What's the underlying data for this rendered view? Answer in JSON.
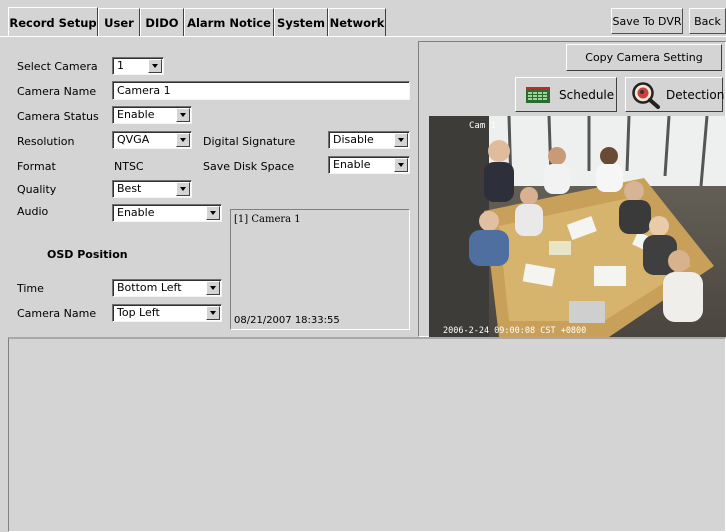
{
  "tabs": [
    {
      "label": "Record Setup",
      "active": true
    },
    {
      "label": "User"
    },
    {
      "label": "DIDO"
    },
    {
      "label": "Alarm Notice"
    },
    {
      "label": "System"
    },
    {
      "label": "Network"
    }
  ],
  "toolbar": {
    "save_label": "Save To DVR",
    "back_label": "Back"
  },
  "form": {
    "select_camera": {
      "label": "Select Camera",
      "value": "1"
    },
    "camera_name": {
      "label": "Camera Name",
      "value": "Camera 1"
    },
    "camera_status": {
      "label": "Camera Status",
      "value": "Enable"
    },
    "resolution": {
      "label": "Resolution",
      "value": "QVGA"
    },
    "format": {
      "label": "Format",
      "value": "NTSC"
    },
    "quality": {
      "label": "Quality",
      "value": "Best"
    },
    "audio": {
      "label": "Audio",
      "value": "Enable"
    },
    "digital_signature": {
      "label": "Digital Signature",
      "value": "Disable"
    },
    "save_disk_space": {
      "label": "Save Disk Space",
      "value": "Enable"
    }
  },
  "osd": {
    "heading": "OSD Position",
    "time": {
      "label": "Time",
      "value": "Bottom Left"
    },
    "camera_name": {
      "label": "Camera Name",
      "value": "Top Left"
    },
    "preview_camera_text": "[1] Camera 1",
    "preview_time_text": "08/21/2007 18:33:55"
  },
  "right": {
    "copy_label": "Copy Camera Setting",
    "schedule_label": "Schedule",
    "detection_label": "Detection",
    "video_overlay_top": "Cam 1",
    "video_overlay_bottom": "2006-2-24 09:00:08 CST +0800"
  }
}
